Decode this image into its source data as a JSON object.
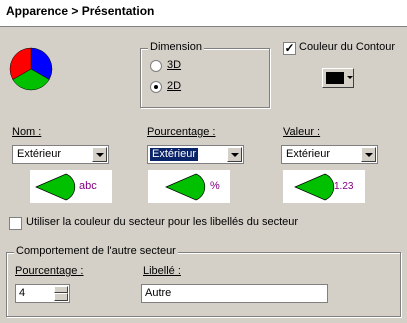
{
  "header": {
    "title": "Apparence > Présentation"
  },
  "dimension": {
    "legend": "Dimension",
    "options": [
      {
        "label": "3D",
        "checked": false
      },
      {
        "label": "2D",
        "checked": true
      }
    ]
  },
  "couleur_contour": {
    "label": "Couleur du Contour",
    "checked": true,
    "color": "#000000"
  },
  "labels": {
    "nom": {
      "label": "Nom :",
      "value": "Extérieur",
      "preview_text": "abc"
    },
    "pourcentage": {
      "label": "Pourcentage :",
      "value": "Extérieur",
      "preview_text": "%"
    },
    "valeur": {
      "label": "Valeur :",
      "value": "Extérieur",
      "preview_text": "1.23"
    }
  },
  "utiliser_couleur": {
    "label": "Utiliser la couleur du secteur pour les libellés du secteur",
    "checked": false
  },
  "autre_secteur": {
    "legend": "Comportement de l'autre secteur",
    "pourcentage_label": "Pourcentage :",
    "pourcentage_value": "4",
    "libelle_label": "Libellé :",
    "libelle_value": "Autre"
  },
  "colors": {
    "pie_red": "#ff0000",
    "pie_blue": "#0000ff",
    "pie_green": "#00c000",
    "preview_green": "#00c000",
    "preview_text": "#800080"
  }
}
